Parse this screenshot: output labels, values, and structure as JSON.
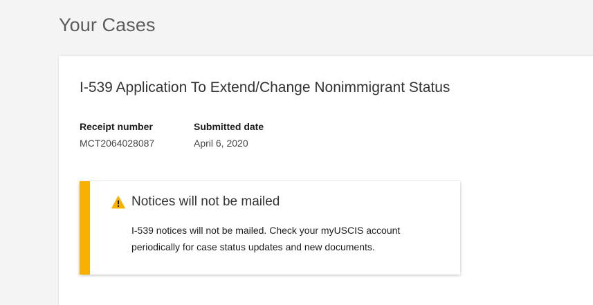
{
  "page": {
    "title": "Your Cases"
  },
  "case": {
    "title": "I-539 Application To Extend/Change Nonimmigrant Status",
    "receipt_label": "Receipt number",
    "receipt_value": "MCT2064028087",
    "submitted_label": "Submitted date",
    "submitted_value": "April 6, 2020"
  },
  "notice": {
    "icon": "warning-icon",
    "title": "Notices will not be mailed",
    "body": "I-539 notices will not be mailed. Check your myUSCIS account periodically for case status updates and new documents.",
    "accent_color": "#f9b000"
  }
}
